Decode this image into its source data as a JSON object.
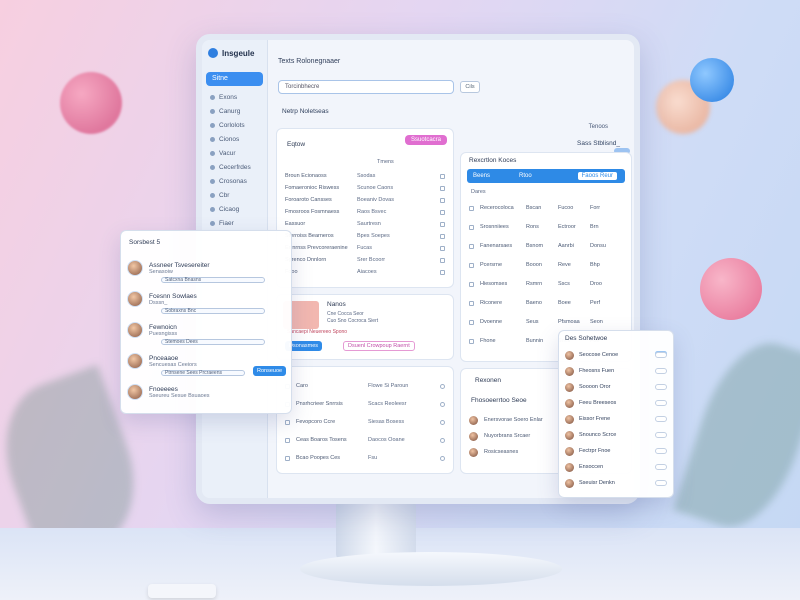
{
  "app": {
    "name": "Insgeule",
    "page_title": "Texts Rolonegnaaer"
  },
  "sidebar": {
    "active": "Sitne",
    "items": [
      "Exons",
      "Canurg",
      "Corlolots",
      "Cionos",
      "Vacur",
      "Cecerfrdes",
      "Crosonas",
      "Cbr",
      "Cicaog",
      "Fiaer"
    ]
  },
  "search": {
    "value": "Torcinbhecre",
    "button": "Cils"
  },
  "subheader": {
    "title": "Netrp Noletseas",
    "link": "Tenoos",
    "user": "Sass Stblisnd_",
    "pill_color": "#9dc3f1"
  },
  "card_left": {
    "title": "Eqtow",
    "button": "Ssuotcacra",
    "col_head": "Tmens",
    "rows": [
      [
        "Broun Ecionaoss",
        "Ssodas"
      ],
      [
        "Fomaeronioc Riswess",
        "Scunoe Caons"
      ],
      [
        "Foroaroto Cansses",
        "Boeaniv Dovas"
      ],
      [
        "Fmosroos Fosmnaess",
        "Raos Bsvec"
      ],
      [
        "Eassuor",
        "Saurtresn"
      ],
      [
        "Sterroiss Bearneros",
        "Bpes Soepes"
      ],
      [
        "Errnrnss Prevcoreraenine",
        "Fucas"
      ],
      [
        "Sgrenco Dnnlorn",
        "Srer Bcoorr"
      ],
      [
        "Fooo",
        "Aiacoes"
      ]
    ]
  },
  "card_promo": {
    "title": "Nanos",
    "lines": [
      "Cne Cocca Seor",
      "Cuo Sno Cocroca Siert",
      "Sancaepi Neuereeo Spono"
    ],
    "button_primary": "Dsonasmes",
    "button_secondary": "Dsuenl Crowpoup Raernt"
  },
  "card_bottom_left": {
    "rows": [
      [
        "Caro",
        "Flowe Si Paroun"
      ],
      [
        "Pnsrhcrieer Snrrsis",
        "Scacs Reoleesr"
      ],
      [
        "Fevopcoro Ccre",
        "Siesas Bosess"
      ],
      [
        "Ceas Boaros Tosens",
        "Daocos Ooane"
      ],
      [
        "Bcao Poopes Ces",
        "Fsu"
      ]
    ]
  },
  "card_table": {
    "title": "Rexcrtlon Koces",
    "bar_left": "Beens",
    "bar_mid": "Rtoo",
    "bar_tag": "Faoos Reur",
    "col_head": "Dares",
    "rows": [
      [
        "Recerocoloca",
        "Bscan",
        "Fucoo",
        "Forr"
      ],
      [
        "Srosnniiees",
        "Rons",
        "Ectroor",
        "Brn"
      ],
      [
        "Fanenarsaes",
        "Bsnom",
        "Aanrbi",
        "Donsu"
      ],
      [
        "Pcersrne",
        "Booon",
        "Reve",
        "Bhp"
      ],
      [
        "Hiesomses",
        "Rsmrn",
        "Sscs",
        "Droo"
      ],
      [
        "Riconere",
        "Baeno",
        "Boee",
        "Perf"
      ],
      [
        "Dvoenne",
        "Seus",
        "Pfsmoaa",
        "Seon"
      ],
      [
        "Fhone",
        "Bunnin",
        "Sncs",
        "Foe"
      ]
    ]
  },
  "card_footer": {
    "title": "Rexonen",
    "heading": "Fhosoeerrtoo Seoe",
    "rows": [
      "Enersvorae Soero Enlar",
      "Nuyorbrans Srcaer",
      "Rosicseasnes"
    ]
  },
  "left_panel": {
    "title": "Sorsbest 5",
    "people": [
      {
        "name": "Assneer Tsvesereiter",
        "meta": "Senasoiw",
        "field": "Satcxna Bnasns"
      },
      {
        "name": "Fcesnn Sowlaes",
        "meta": "Dsssn_",
        "field": "Sobraxns Bnc"
      },
      {
        "name": "Fewnoicn",
        "meta": "Puesngisss",
        "field": "Stemoes Dees"
      },
      {
        "name": "Pnceaaoe",
        "meta": "Sencuesas Ceeiors",
        "field": "Ptrnsene Sees Prcraeens",
        "button": "Ronseuoe"
      },
      {
        "name": "Fnoeeees",
        "meta": "Sseureu Sesue Bsuaoes",
        "field": ""
      }
    ]
  },
  "right_panel": {
    "title": "Des Sohetwoe",
    "rows": [
      "Seocose Cenoe",
      "Fheosns Fuen",
      "Soooon Oror",
      "Feeu Breeseos",
      "Eissor Frene",
      "Snounco Scrce",
      "Fectrpr Fnoe",
      "Ensoccen",
      "Sseuisr Denkn"
    ]
  }
}
